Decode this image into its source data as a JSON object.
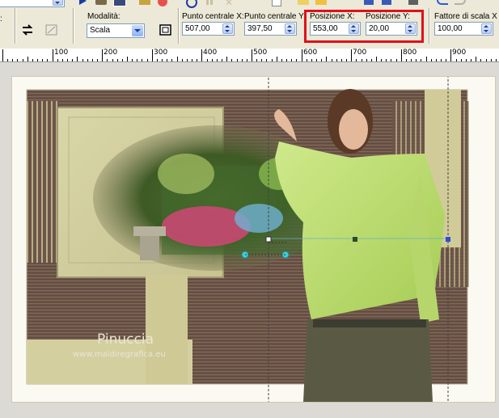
{
  "toolbar": {
    "mode_label": "Modalità:",
    "mode_value": "Scala",
    "center_x_label": "Punto centrale X:",
    "center_x_value": "507,00",
    "center_y_label": "Punto centrale Y:",
    "center_y_value": "397,50",
    "pos_x_label": "Posizione X:",
    "pos_x_value": "553,00",
    "pos_y_label": "Posizione Y:",
    "pos_y_value": "20,00",
    "scale_label": "Fattore di scala X (%",
    "scale_value": "100,00",
    "left_cut_label": ":",
    "highlight_color": "#e0101a"
  },
  "ruler": {
    "labels": [
      "100",
      "200",
      "300",
      "400",
      "500",
      "600",
      "700",
      "800",
      "900"
    ]
  },
  "canvas": {
    "watermark_name": "Pinuccia",
    "watermark_url": "www.maidiregrafica.eu"
  },
  "icons": [
    "rotate-icon",
    "deform-icon",
    "reset-icon",
    "undo-icon",
    "save-icon"
  ]
}
